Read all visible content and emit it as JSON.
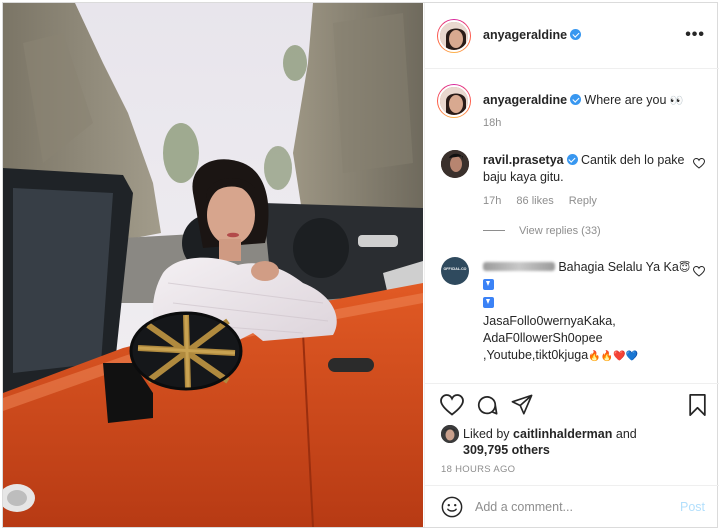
{
  "header": {
    "username": "anyageraldine",
    "verified": true,
    "more_icon": "more-horizontal-icon",
    "more_label": "•••"
  },
  "caption": {
    "username": "anyageraldine",
    "text": "Where are you",
    "emoji": "👀",
    "time": "18h"
  },
  "comments": [
    {
      "username": "ravil.prasetya",
      "verified": true,
      "text": "Cantik deh lo pake baju kaya gitu.",
      "time": "17h",
      "likes": "86 likes",
      "reply_label": "Reply",
      "view_replies": "View replies (33)"
    },
    {
      "username_hidden": true,
      "avatar_label": "OFFICIAL.CO",
      "text_line1": "Bahagia Selalu Ya Ka",
      "emoji1": "😇",
      "text_line2": "JasaFollo0wernyaKaka,",
      "text_line3": "AdaF0llowerSh0opee",
      "text_line4": ",Youtube,tikt0kjuga",
      "emoji_tail": "🔥🔥❤️💙"
    }
  ],
  "likes": {
    "prefix": "Liked by",
    "user": "caitlinhalderman",
    "and": "and",
    "others": "309,795 others"
  },
  "timestamp": "18 HOURS AGO",
  "add_comment": {
    "placeholder": "Add a comment...",
    "post_label": "Post"
  },
  "colors": {
    "verified": "#3897f0",
    "text": "#262626",
    "muted": "#8e8e8e",
    "post_disabled": "#b2dffc",
    "car_orange": "#d8491d"
  }
}
